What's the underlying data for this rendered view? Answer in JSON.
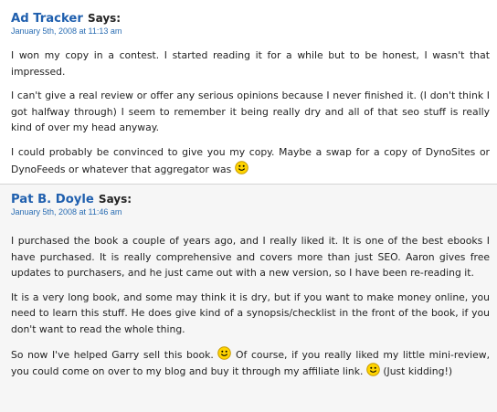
{
  "comments": [
    {
      "author": "Ad Tracker",
      "says": "Says:",
      "date": "January 5th, 2008 at 11:13 am",
      "paragraphs": [
        "I won my copy in a contest. I started reading it for a while but to be honest, I wasn't that impressed.",
        "I can't give a real review or offer any serious opinions because I never finished it. (I don't think I got halfway through) I seem to remember it being really dry and all of that seo stuff is really kind of over my head anyway.",
        "I could probably be convinced to give you my copy. Maybe a swap for a copy of DynoSites or DynoFeeds or whatever that aggregator was"
      ]
    },
    {
      "author": "Pat B. Doyle",
      "says": "Says:",
      "date": "January 5th, 2008 at 11:46 am",
      "paragraphs": [
        "I purchased the book a couple of years ago, and I really liked it. It is one of the best ebooks I have purchased. It is really comprehensive and covers more than just SEO. Aaron gives free updates to purchasers, and he just came out with a new version, so I have been re-reading it.",
        "It is a very long book, and some may think it is dry, but if you want to make money online, you need to learn this stuff. He does give kind of a synopsis/checklist in the front of the book, if you don't want to read the whole thing."
      ],
      "last_paragraph": {
        "part1": "So now I've helped Garry sell this book.",
        "part2": " Of course, if you really liked my little mini-review, you could come on over to my blog and buy it through my affiliate link.",
        "part3": " (Just kidding!)"
      }
    }
  ],
  "smiley": {
    "icon": "smiley-face-icon",
    "face_color": "#ffd400",
    "outline_color": "#c79a00"
  }
}
